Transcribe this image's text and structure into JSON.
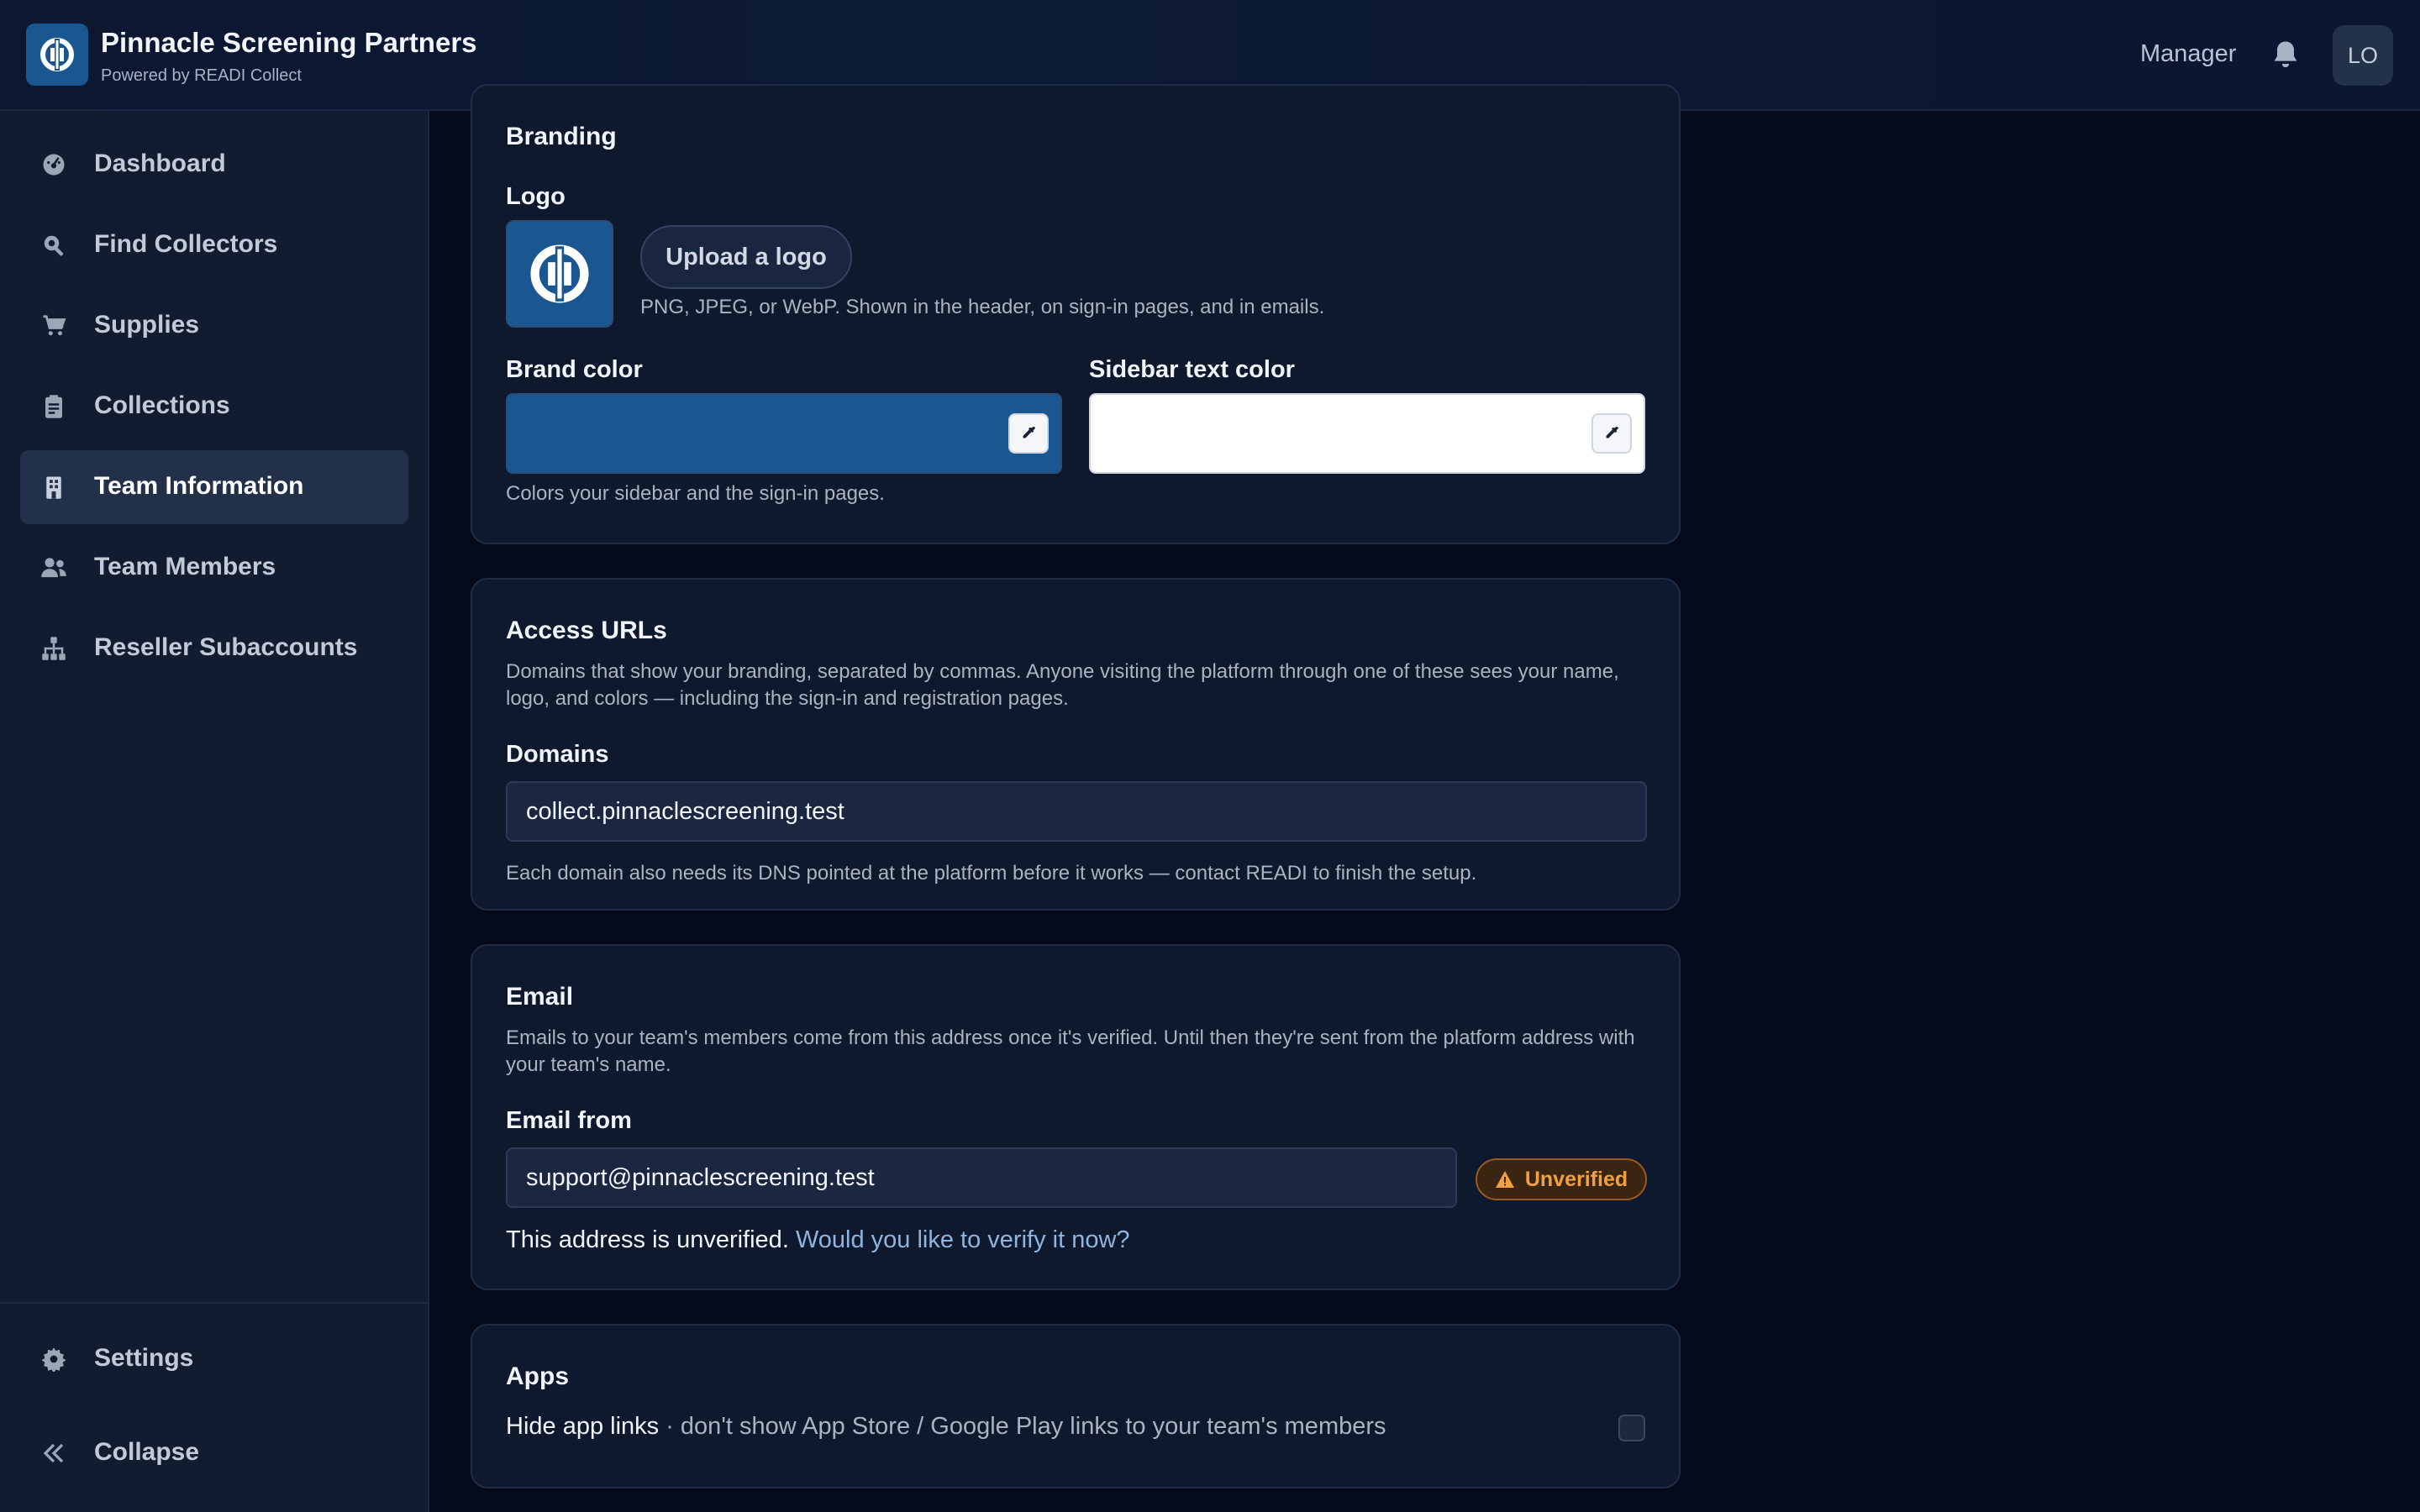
{
  "header": {
    "title": "Pinnacle Screening Partners",
    "subtitle": "Powered by READI Collect",
    "role": "Manager",
    "avatar_initials": "LO"
  },
  "sidebar": {
    "items": [
      {
        "label": "Dashboard",
        "icon": "gauge-icon"
      },
      {
        "label": "Find Collectors",
        "icon": "search-icon"
      },
      {
        "label": "Supplies",
        "icon": "cart-icon"
      },
      {
        "label": "Collections",
        "icon": "clipboard-icon"
      },
      {
        "label": "Team Information",
        "icon": "building-icon",
        "active": true
      },
      {
        "label": "Team Members",
        "icon": "users-icon"
      },
      {
        "label": "Reseller Subaccounts",
        "icon": "hierarchy-icon"
      }
    ],
    "settings_label": "Settings",
    "collapse_label": "Collapse"
  },
  "branding": {
    "title": "Branding",
    "logo_label": "Logo",
    "upload_label": "Upload a logo",
    "logo_help": "PNG, JPEG, or WebP. Shown in the header, on sign-in pages, and in emails.",
    "brand_color_label": "Brand color",
    "brand_color": "#1a568f",
    "sidebar_text_color_label": "Sidebar text color",
    "sidebar_text_color": "#ffffff",
    "colors_help": "Colors your sidebar and the sign-in pages."
  },
  "access_urls": {
    "title": "Access URLs",
    "description": "Domains that show your branding, separated by commas. Anyone visiting the platform through one of these sees your name, logo, and colors — including the sign-in and registration pages.",
    "domains_label": "Domains",
    "domains_value": "collect.pinnaclescreening.test",
    "dns_help": "Each domain also needs its DNS pointed at the platform before it works — contact READI to finish the setup."
  },
  "email": {
    "title": "Email",
    "description": "Emails to your team's members come from this address once it's verified. Until then they're sent from the platform address with your team's name.",
    "from_label": "Email from",
    "from_value": "support@pinnaclescreening.test",
    "status_badge": "Unverified",
    "status_color": "#f0a040",
    "unverified_text": "This address is unverified.",
    "verify_link": "Would you like to verify it now?"
  },
  "apps": {
    "title": "Apps",
    "hide_links_label": "Hide app links",
    "hide_links_desc": " · don't show App Store / Google Play links to your team's members",
    "hide_links_checked": false
  }
}
